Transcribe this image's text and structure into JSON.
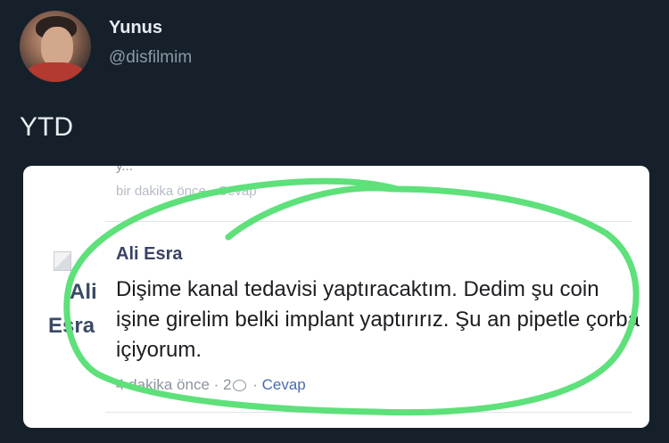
{
  "tweet": {
    "author_name": "Yunus",
    "author_handle": "@disfilmim",
    "text": "YTD"
  },
  "screenshot_card": {
    "previous_comment": {
      "cut_text": "y...",
      "meta": "bir dakika önce · Cevap"
    },
    "comment": {
      "avatar_alt_line1": "Ali",
      "avatar_alt_line2": "Esra",
      "author": "Ali Esra",
      "body": "Dişime kanal tedavisi yaptıracaktım. Dedim şu coin işine girelim belki implant yaptırırız. Şu an pipetle çorba içiyorum.",
      "time": "4 dakika önce",
      "separator": " · ",
      "reply_count": "2",
      "reply_label": "Cevap"
    }
  },
  "colors": {
    "background": "#16202b",
    "highlight": "#5ee07a",
    "card": "#ffffff",
    "link": "#4a6bb0"
  },
  "icons": [
    "avatar",
    "broken-image-icon",
    "comment-bubble-icon"
  ]
}
